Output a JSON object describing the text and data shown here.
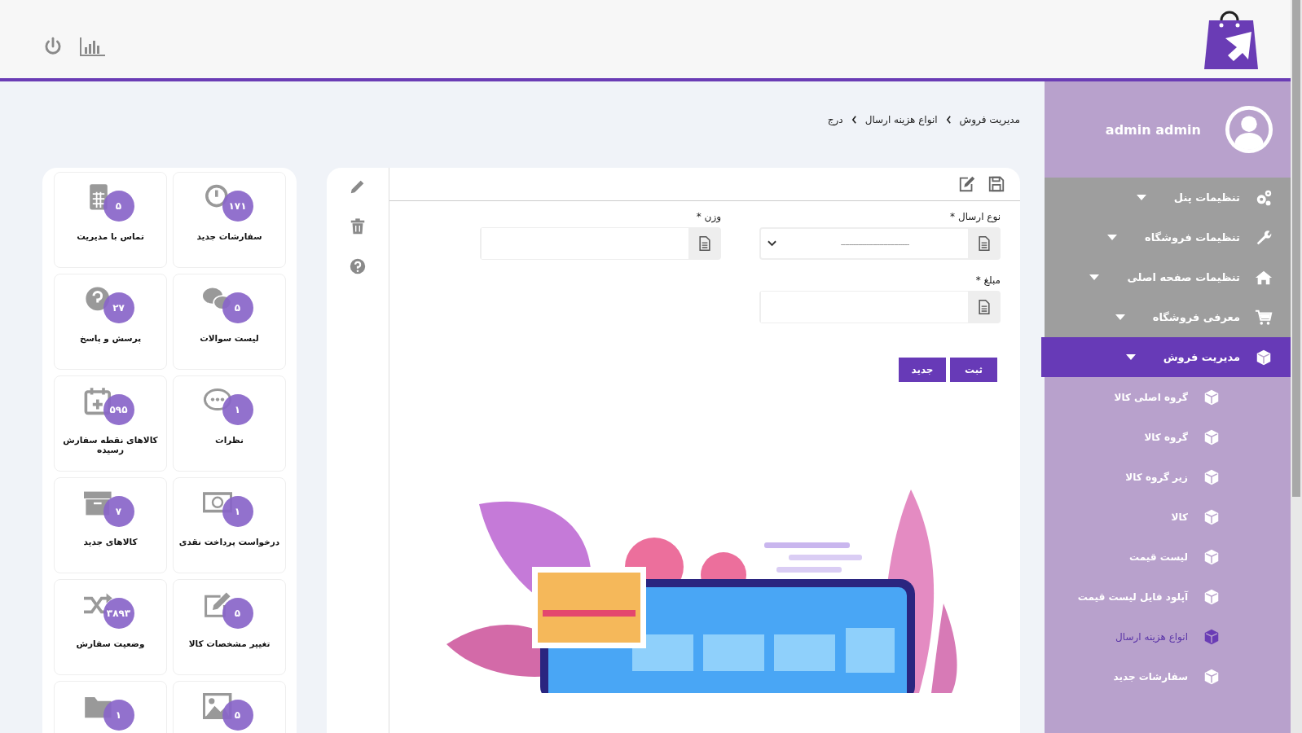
{
  "breadcrumb": [
    "مدیریت فروش",
    "انواع هزینه ارسال",
    "درج"
  ],
  "sidebar": {
    "user_name": "admin admin",
    "items": [
      {
        "label": "تنظیمات پنل",
        "selected": false
      },
      {
        "label": "تنظیمات فروشگاه",
        "selected": false
      },
      {
        "label": "تنظیمات صفحه اصلی",
        "selected": false
      },
      {
        "label": "معرفی فروشگاه",
        "selected": false
      },
      {
        "label": "مدیریت فروش",
        "selected": true,
        "children": [
          {
            "label": "گروه اصلی کالا",
            "selected": false
          },
          {
            "label": "گروه کالا",
            "selected": false
          },
          {
            "label": "زیر گروه کالا",
            "selected": false
          },
          {
            "label": "کالا",
            "selected": false
          },
          {
            "label": "لیست قیمت",
            "selected": false
          },
          {
            "label": "آپلود فایل لیست قیمت",
            "selected": false
          },
          {
            "label": "انواع هزینه ارسال",
            "selected": true
          },
          {
            "label": "سفارشات جدید",
            "selected": false
          }
        ]
      }
    ]
  },
  "form": {
    "fields": [
      {
        "kind": "select",
        "label": "نوع ارسال *",
        "value": "--------------------------------"
      },
      {
        "kind": "text",
        "label": "وزن *"
      },
      {
        "kind": "text",
        "label": "مبلغ *"
      }
    ],
    "buttons": [
      "ثبت",
      "جدید"
    ]
  },
  "tiles": [
    {
      "count": "۱۷۱",
      "label": "سفارشات جدید"
    },
    {
      "count": "۵",
      "label": "تماس با مدیریت"
    },
    {
      "count": "۵",
      "label": "لیست سوالات"
    },
    {
      "count": "۲۷",
      "label": "پرسش و پاسخ"
    },
    {
      "count": "۱",
      "label": "نظرات"
    },
    {
      "count": "۵۹۵",
      "label": "کالاهای نقطه سفارش رسیده"
    },
    {
      "count": "۱",
      "label": "درخواست پرداخت نقدی"
    },
    {
      "count": "۷",
      "label": "کالاهای جدید"
    },
    {
      "count": "۵",
      "label": "تغییر مشخصات کالا"
    },
    {
      "count": "۳۸۹۳",
      "label": "وضعیت سفارش"
    },
    {
      "count": "۵"
    },
    {
      "count": "۱"
    }
  ]
}
